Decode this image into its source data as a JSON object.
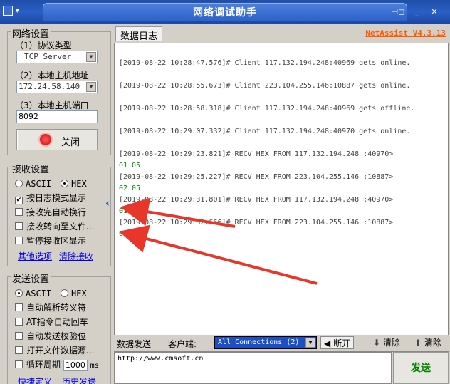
{
  "window": {
    "title": "网络调试助手",
    "sysmenu": "▾",
    "pin": "⊣◻",
    "minimize": "_",
    "close": "✕"
  },
  "network": {
    "group_title": "网络设置",
    "protocol_label": "（1）协议类型",
    "protocol_value": "TCP Server",
    "host_label": "（2）本地主机地址",
    "host_value": "172.24.58.140",
    "port_label": "（3）本地主机端口",
    "port_value": "8092",
    "close_button": "关闭"
  },
  "receive": {
    "group_title": "接收设置",
    "opt_ascii": "ASCII",
    "opt_hex": "HEX",
    "log_mode": "按日志模式显示",
    "auto_newline": "接收完自动换行",
    "to_file": "接收转向至文件...",
    "pause": "暂停接收区显示",
    "more": "其他选项",
    "clear": "清除接收"
  },
  "send": {
    "group_title": "发送设置",
    "opt_ascii": "ASCII",
    "opt_hex": "HEX",
    "auto_escape": "自动解析转义符",
    "at_cr": "AT指令自动回车",
    "checksum": "自动发送校验位",
    "file_source": "打开文件数据源...",
    "loop_label": "循环周期",
    "loop_value": "1000",
    "loop_unit": "ms",
    "shortcut": "快捷定义",
    "history": "历史发送"
  },
  "log": {
    "tab": "数据日志",
    "brand": "NetAssist V4.3.13",
    "lines": [
      "[2019-08-22 10:28:47.576]# Client 117.132.194.248:40969 gets online.",
      "[2019-08-22 10:28:55.673]# Client 223.104.255.146:10887 gets online.",
      "[2019-08-22 10:28:58.318]# Client 117.132.194.248:40969 gets offline.",
      "[2019-08-22 10:29:07.332]# Client 117.132.194.248:40970 gets online.",
      "[2019-08-22 10:29:23.821]# RECV HEX FROM 117.132.194.248 :40970>",
      "01 05",
      "[2019-08-22 10:29:25.227]# RECV HEX FROM 223.104.255.146 :10887>",
      "02 05",
      "[2019-08-22 10:29:31.801]# RECV HEX FROM 117.132.194.248 :40970>",
      "01 05",
      "[2019-08-22 10:29:32.666]# RECV HEX FROM 223.104.255.146 :10887>",
      "02 05"
    ]
  },
  "bottom": {
    "tab": "数据发送",
    "client_label": "客户端:",
    "connections": "All Connections (2)",
    "disconnect": "断开",
    "clear1": "清除",
    "clear2": "清除",
    "send_text": "http://www.cmsoft.cn",
    "send_button": "发送"
  },
  "colors": {
    "titlebar": "#2a5fc6",
    "brand": "#ff5a00",
    "recv": "#008000",
    "arrow": "#e8362a"
  }
}
